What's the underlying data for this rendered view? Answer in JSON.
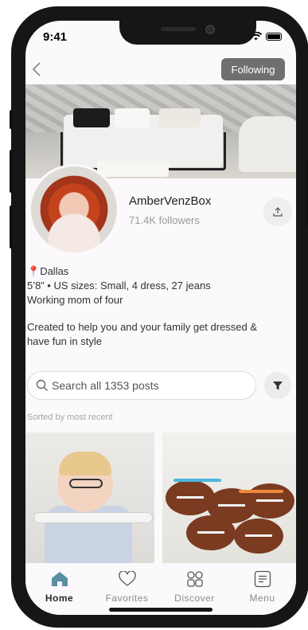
{
  "status_bar": {
    "time": "9:41"
  },
  "nav": {
    "following_label": "Following"
  },
  "profile": {
    "name": "AmberVenzBox",
    "followers": "71.4K followers"
  },
  "bio": {
    "location": "Dallas",
    "sizes": "5’8” • US sizes: Small, 4 dress, 27 jeans",
    "tagline": "Working mom of four",
    "description": "Created to help you and your family get dressed & have fun in style"
  },
  "search": {
    "placeholder": "Search all 1353 posts"
  },
  "sort_label": "Sorted by most recent",
  "tabs": [
    {
      "label": "Home",
      "icon": "home-icon",
      "active": true
    },
    {
      "label": "Favorites",
      "icon": "heart-icon",
      "active": false
    },
    {
      "label": "Discover",
      "icon": "grid-icon",
      "active": false
    },
    {
      "label": "Menu",
      "icon": "menu-icon",
      "active": false
    }
  ],
  "colors": {
    "accent_home": "#5a8ea3",
    "following_bg": "#6f6f6f",
    "pin": "#e5484d"
  }
}
